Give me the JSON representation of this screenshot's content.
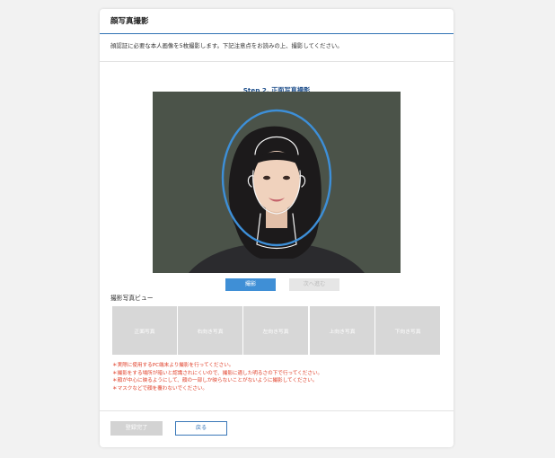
{
  "card": {
    "title": "顔写真撮影",
    "intro": "顔認証に必要な本人画像を5枚撮影します。下記注意点をお読みの上、撮影してください。"
  },
  "step": {
    "title": "Step 2. 正面写真撮影"
  },
  "buttons": {
    "capture": "撮影",
    "next": "次へ進む",
    "complete": "登録完了",
    "back": "戻る"
  },
  "preview": {
    "label": "撮影写真ビュー",
    "slots": [
      "正面写真",
      "右向き写真",
      "左向き写真",
      "上向き写真",
      "下向き写真"
    ]
  },
  "notes": [
    "＊実際に使用するPC端末より撮影を行ってください。",
    "＊撮影をする場所が暗いと認識されにくいので、撮影に適した明るさの下で行ってください。",
    "＊顔が中心に映るようにして、顔の一部しか映らないことがないように撮影してください。",
    "＊マスクなどで顔を覆わないでください。"
  ],
  "colors": {
    "accent": "#3f8fd6",
    "header_line": "#2f72b4",
    "note_text": "#e0402a",
    "disabled": "#d7d7d7"
  }
}
